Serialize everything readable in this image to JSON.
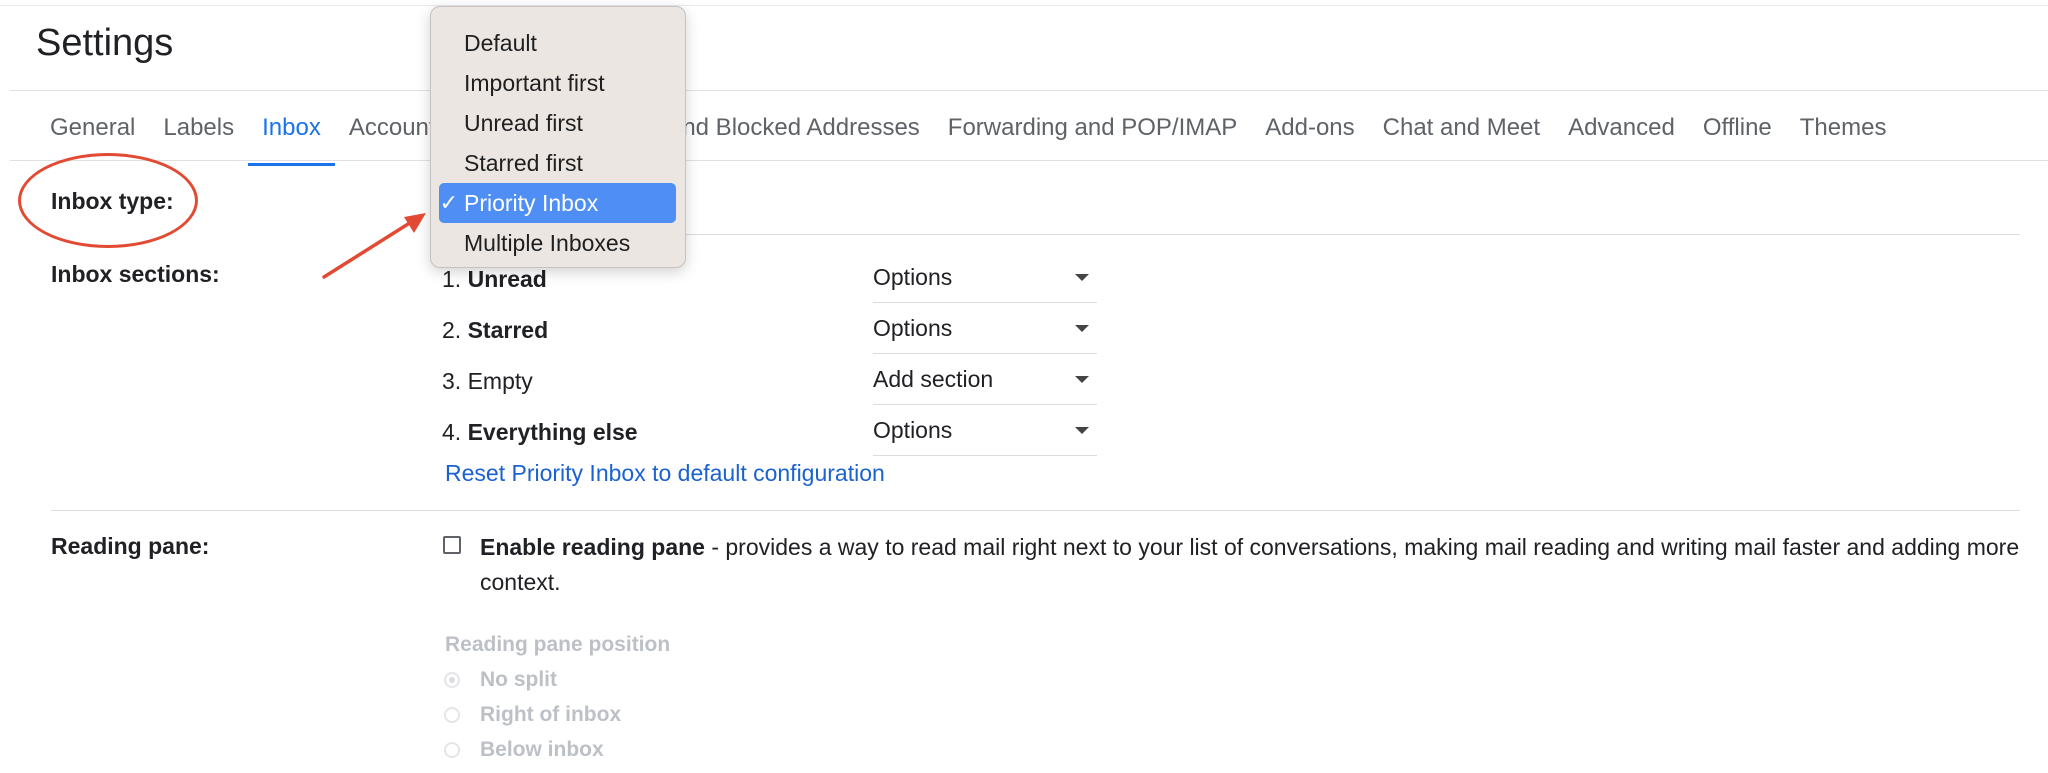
{
  "page": {
    "title": "Settings"
  },
  "tabs": [
    {
      "label": "General"
    },
    {
      "label": "Labels"
    },
    {
      "label": "Inbox",
      "active": true
    },
    {
      "label": "Accounts and Import"
    },
    {
      "label": "Filters and Blocked Addresses"
    },
    {
      "label": "Forwarding and POP/IMAP"
    },
    {
      "label": "Add-ons"
    },
    {
      "label": "Chat and Meet"
    },
    {
      "label": "Advanced"
    },
    {
      "label": "Offline"
    },
    {
      "label": "Themes"
    }
  ],
  "inbox_type": {
    "label": "Inbox type:",
    "menu": {
      "items": [
        {
          "label": "Default"
        },
        {
          "label": "Important first"
        },
        {
          "label": "Unread first"
        },
        {
          "label": "Starred first"
        },
        {
          "label": "Priority Inbox",
          "selected": true,
          "check": "✓"
        },
        {
          "label": "Multiple Inboxes"
        }
      ]
    }
  },
  "inbox_sections": {
    "label": "Inbox sections:",
    "rows": [
      {
        "num": "1.",
        "name": "Unread",
        "bold": true,
        "control": "Options"
      },
      {
        "num": "2.",
        "name": "Starred",
        "bold": true,
        "control": "Options"
      },
      {
        "num": "3.",
        "name": "Empty",
        "bold": false,
        "control": "Add section"
      },
      {
        "num": "4.",
        "name": "Everything else",
        "bold": true,
        "control": "Options"
      }
    ],
    "reset_link": "Reset Priority Inbox to default configuration"
  },
  "reading_pane": {
    "label": "Reading pane:",
    "enable_label": "Enable reading pane",
    "enable_desc": " - provides a way to read mail right next to your list of conversations, making mail reading and writing mail faster and adding more context.",
    "enabled": false,
    "position_label": "Reading pane position",
    "positions": [
      {
        "label": "No split",
        "checked": true
      },
      {
        "label": "Right of inbox",
        "checked": false
      },
      {
        "label": "Below inbox",
        "checked": false
      }
    ]
  },
  "colors": {
    "accent": "#1a73e8",
    "menu_selected": "#4f8ff5",
    "annotation": "#e24a33"
  }
}
